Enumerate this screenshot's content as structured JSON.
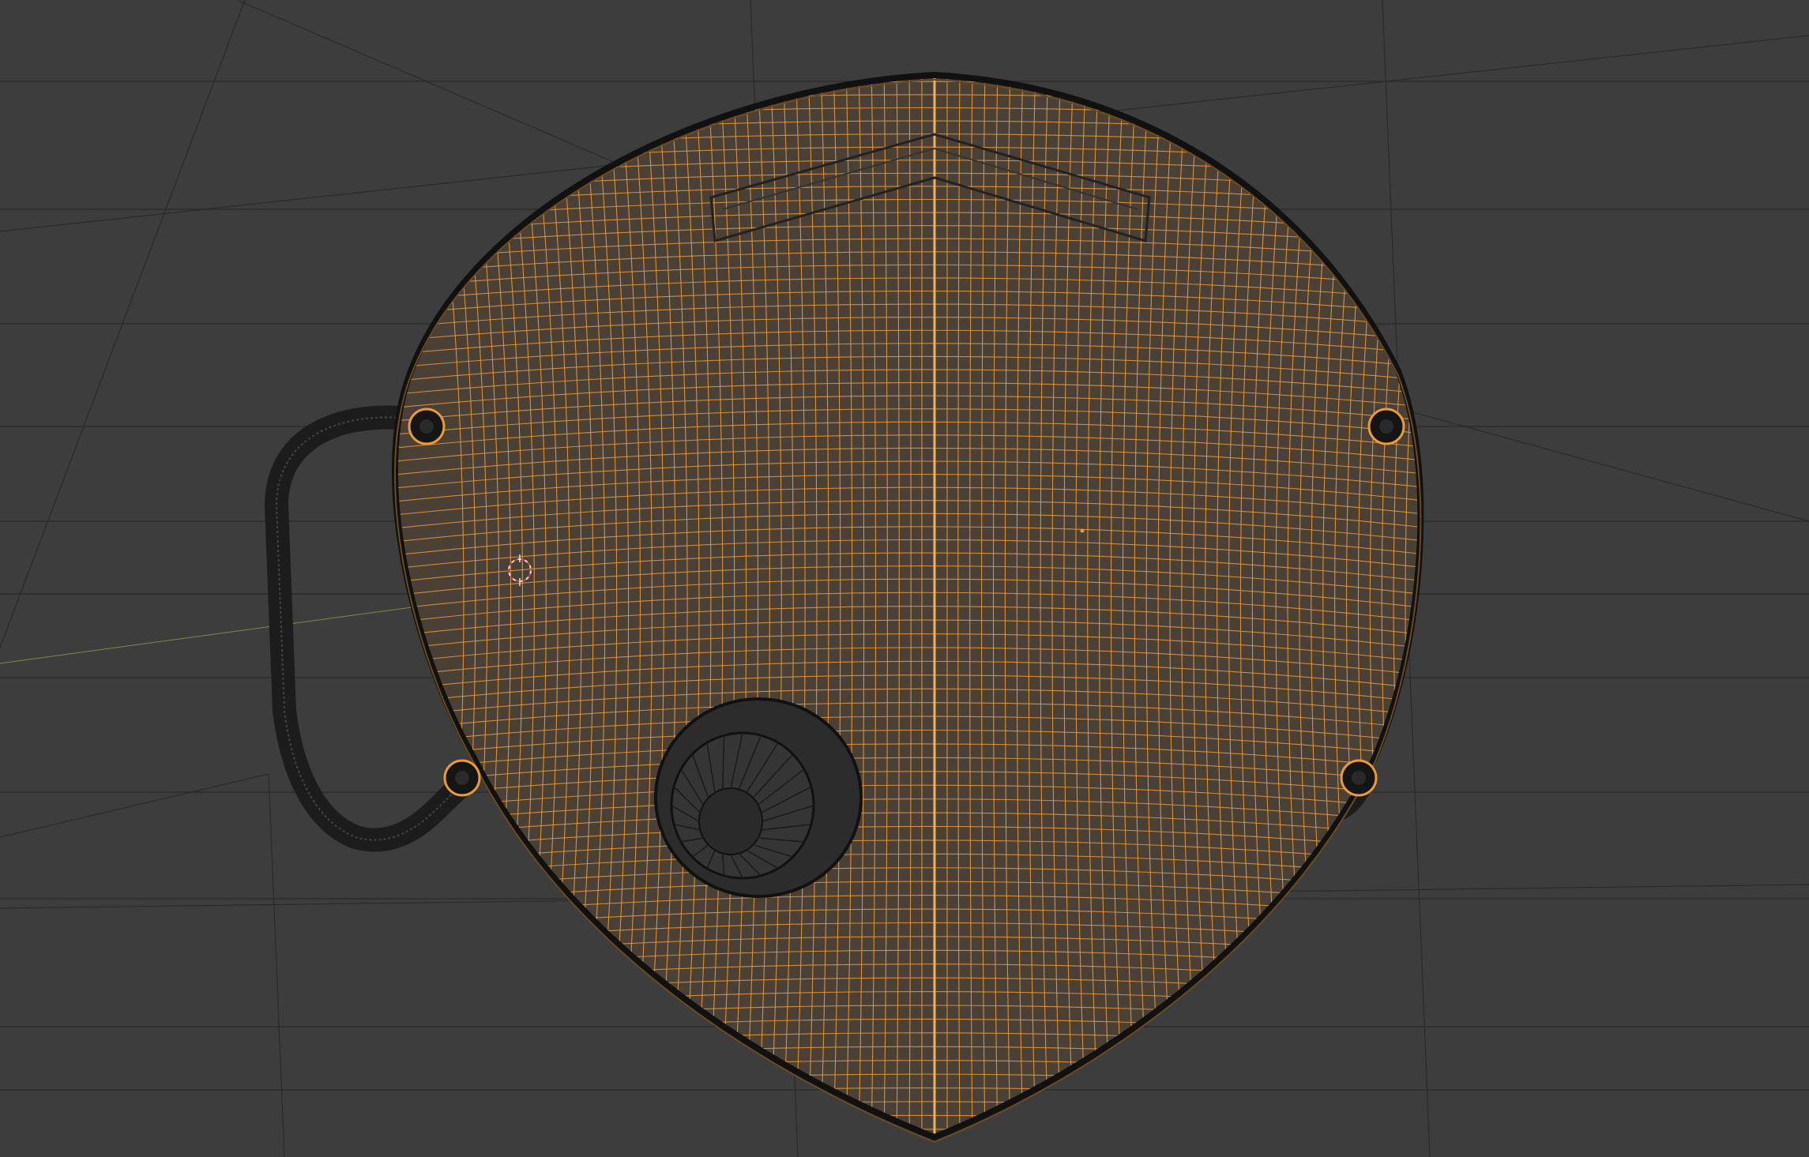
{
  "viewport": {
    "mode": "wireframe-edit",
    "background_color": "#3d3d3d",
    "grid_line_color": "#2a2a2a",
    "world_axis_x_color": "#7d8a4a",
    "selection_wire_color": "#e89a3c",
    "mesh_wire_color": "#111111"
  },
  "scene": {
    "object": "respirator-mask",
    "parts": [
      "mask-shell",
      "nose-foam-strip",
      "exhalation-valve",
      "left-ear-loop",
      "right-ear-loop",
      "loop-anchor-points"
    ]
  },
  "cursor": {
    "icon": "3d-cursor-icon"
  }
}
